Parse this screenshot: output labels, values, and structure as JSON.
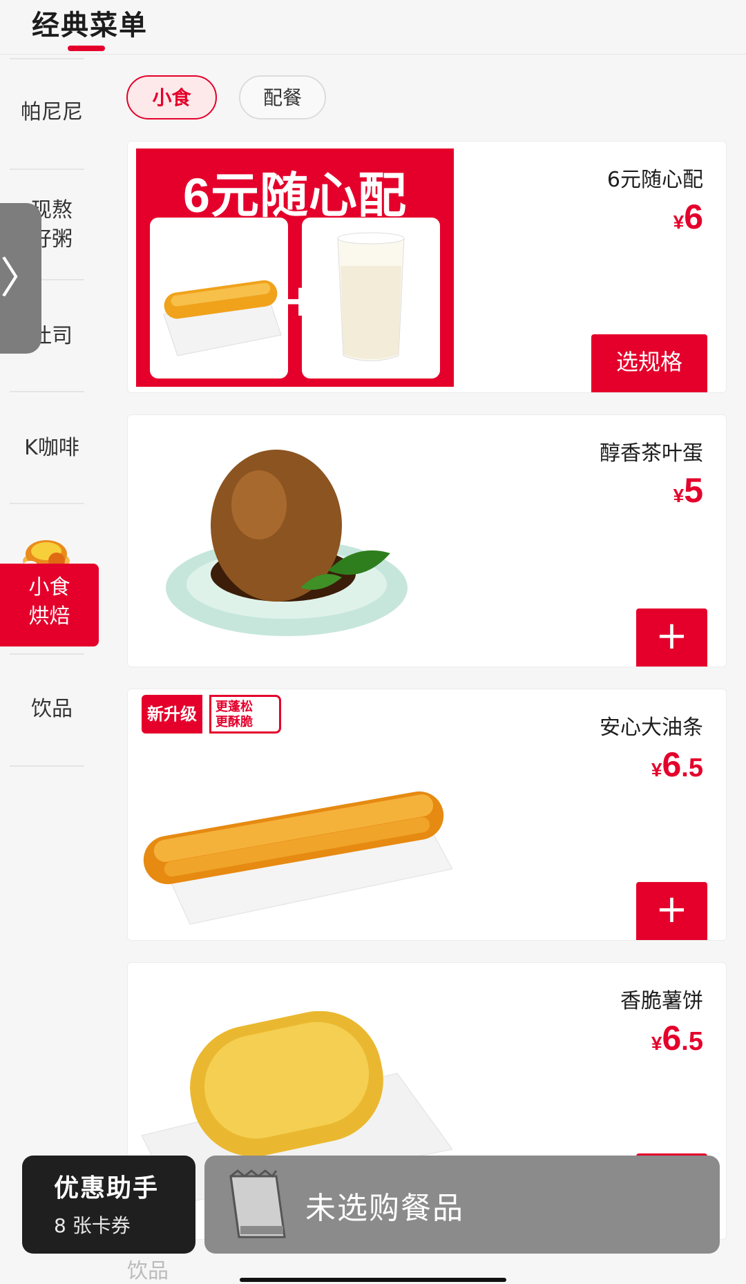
{
  "header": {
    "title": "经典菜单"
  },
  "sidebar": {
    "items": [
      {
        "label": "帕尼尼"
      },
      {
        "label_line1": "现熬",
        "label_line2": "好粥"
      },
      {
        "label": "吐司"
      },
      {
        "label": "K咖啡"
      },
      {
        "label_line1": "小食",
        "label_line2": "烘焙"
      },
      {
        "label": "饮品"
      }
    ],
    "active_index": 4
  },
  "handle": {
    "icon": "chevron-right-icon",
    "glyph": "〉"
  },
  "filters": [
    {
      "label": "小食",
      "active": true
    },
    {
      "label": "配餐",
      "active": false
    }
  ],
  "products": [
    {
      "name": "6元随心配",
      "price_symbol": "¥",
      "price_int": "6",
      "price_dec": "",
      "action_label": "选规格",
      "promo_title": "6元随心配",
      "promo_plus": "+"
    },
    {
      "name": "醇香茶叶蛋",
      "price_symbol": "¥",
      "price_int": "5",
      "price_dec": "",
      "action_label": "+"
    },
    {
      "name": "安心大油条",
      "price_symbol": "¥",
      "price_int": "6",
      "price_dec": ".5",
      "action_label": "+",
      "badge_main": "新升级",
      "badge_sub1": "更蓬松",
      "badge_sub2": "更酥脆"
    },
    {
      "name": "香脆薯饼",
      "price_symbol": "¥",
      "price_int": "6",
      "price_dec": ".5",
      "action_label": "+"
    }
  ],
  "coupon": {
    "title": "优惠助手",
    "count": "8 张卡券"
  },
  "cart": {
    "empty_text": "未选购餐品",
    "icon": "shopping-bag-icon"
  },
  "peek": {
    "label": "饮品"
  },
  "colors": {
    "accent": "#e4002b",
    "background": "#f6f6f6",
    "cart_bar": "#8b8b8b",
    "coupon_bar": "#1f1f1f"
  }
}
